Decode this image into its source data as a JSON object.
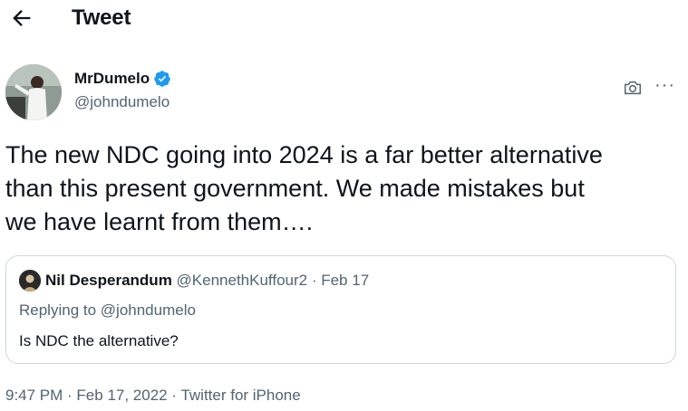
{
  "header": {
    "back_icon": "arrow-left-icon",
    "title": "Tweet"
  },
  "author": {
    "name": "MrDumelo",
    "handle": "@johndumelo",
    "verified_icon": "verified-badge-icon",
    "verified_color": "#1d9bf0"
  },
  "actions": {
    "camera_icon": "camera-icon",
    "more_label": "···"
  },
  "tweet": {
    "text": "The new NDC going into 2024 is a far better alternative\nthan this present government. We made mistakes but\nwe have learnt from  them…."
  },
  "quoted": {
    "name": "Nil Desperandum",
    "handle": "@KennethKuffour2",
    "separator": " · ",
    "date": "Feb 17",
    "replying_prefix": "Replying to ",
    "replying_to": "@johndumelo",
    "text": "Is NDC the alternative?"
  },
  "footer": {
    "time": "9:47 PM",
    "sep1": " · ",
    "date": "Feb 17, 2022",
    "sep2": " · ",
    "source": "Twitter for iPhone"
  }
}
